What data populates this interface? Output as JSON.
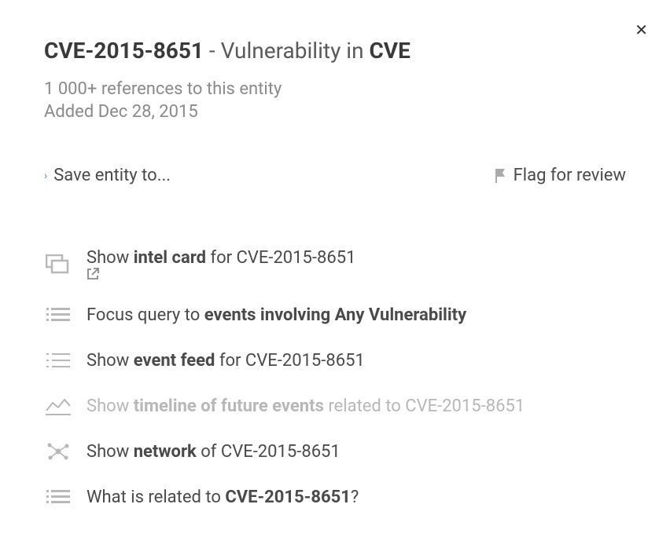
{
  "header": {
    "entity_id": "CVE-2015-8651",
    "sep": " - ",
    "desc_prefix": "Vulnerability in ",
    "source": "CVE",
    "references": "1 000+ references to this entity",
    "added": "Added Dec 28, 2015"
  },
  "actions": {
    "save": "Save entity to...",
    "flag": "Flag for review"
  },
  "options": [
    {
      "icon": "cards",
      "pre": "Show ",
      "bold": "intel card",
      "post": " for CVE-2015-8651",
      "ext": true,
      "disabled": false
    },
    {
      "icon": "list-dense",
      "pre": "Focus query to ",
      "bold": "events involving Any Vulnerability",
      "post": "",
      "ext": false,
      "disabled": false
    },
    {
      "icon": "list",
      "pre": "Show ",
      "bold": "event feed",
      "post": " for CVE-2015-8651",
      "ext": false,
      "disabled": false
    },
    {
      "icon": "timeline",
      "pre": "Show ",
      "bold": "timeline of future events",
      "post": " related to CVE-2015-8651",
      "ext": false,
      "disabled": true
    },
    {
      "icon": "network",
      "pre": "Show ",
      "bold": "network",
      "post": " of CVE-2015-8651",
      "ext": false,
      "disabled": false
    },
    {
      "icon": "list-dense",
      "pre": "What is related to ",
      "bold": "CVE-2015-8651",
      "post": "?",
      "ext": false,
      "disabled": false
    }
  ]
}
